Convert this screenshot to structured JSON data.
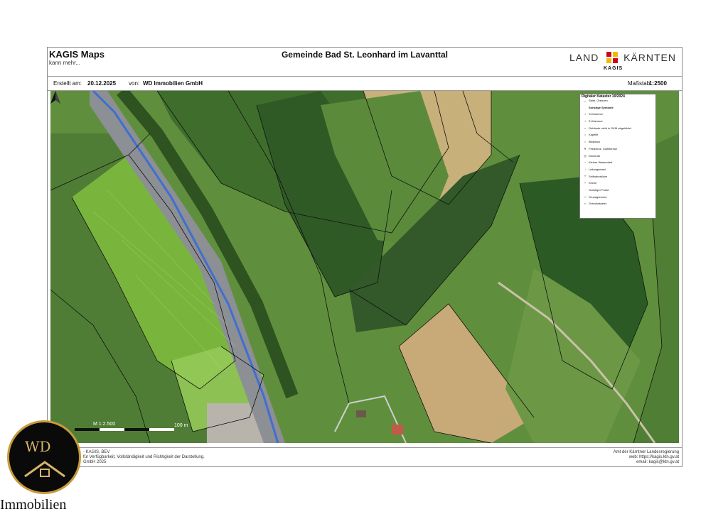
{
  "header": {
    "app_title": "KAGIS Maps",
    "app_subtitle": "kann mehr...",
    "map_title": "Gemeinde Bad St. Leonhard im Lavanttal",
    "logo_left": "LAND",
    "logo_right": "KÄRNTEN",
    "logo_sub": "KAGIS"
  },
  "meta": {
    "created_label": "Erstellt am:",
    "created_date": "20.12.2025",
    "by_label": "von:",
    "by_name": "WD Immobilien GmbH",
    "scale_label": "Maßstab:",
    "scale_value": "1:2500"
  },
  "map": {
    "scale_text": "M 1:2.500",
    "scale_distance": "100 m",
    "north_icon": "north-arrow-icon"
  },
  "legend": {
    "title": "Digitaler Kataster 10/2024",
    "items": [
      {
        "symbol": "—",
        "label": "Strittl. Grenzen"
      },
      {
        "symbol": "",
        "label": "Sonstige Symbole"
      },
      {
        "symbol": "↕",
        "label": "S-Klammer"
      },
      {
        "symbol": "↕",
        "label": "Z-Klammer"
      },
      {
        "symbol": "○",
        "label": "Gebäude nicht in DKM abgebildet"
      },
      {
        "symbol": "♁",
        "label": "Kapelle"
      },
      {
        "symbol": "♁",
        "label": "Bildstock"
      },
      {
        "symbol": "✝",
        "label": "Feldkreuz, Gipfelkreuz"
      },
      {
        "symbol": "◎",
        "label": "Denkmal"
      },
      {
        "symbol": "~",
        "label": "Kleiner Wasserlauf"
      },
      {
        "symbol": "↓",
        "label": "Leitungsmast"
      },
      {
        "symbol": "⊤",
        "label": "Seilbahnstütze"
      },
      {
        "symbol": "+",
        "label": "Kirche"
      },
      {
        "symbol": "·",
        "label": "Sonstiger Punkt"
      },
      {
        "symbol": "□",
        "label": "Grundgrenzen"
      },
      {
        "symbol": "■",
        "label": "Grenzkataster"
      }
    ]
  },
  "footer": {
    "left_lines": [
      "- KAGIS, BEV",
      "für Verfügbarkeit, Vollständigkeit und Richtigkeit der Darstellung.",
      "GmbH 2025"
    ],
    "right_lines": [
      "Amt der Kärntner Landesregierung",
      "web: https://kagis.ktn.gv.at",
      "email: kagis@ktn.gv.at"
    ]
  },
  "brand": {
    "initials": "WD",
    "name": "Immobilien"
  },
  "colors": {
    "kaernten_red": "#d0021b",
    "kaernten_yellow": "#f5b800",
    "brand_gold": "#c79a3a"
  }
}
